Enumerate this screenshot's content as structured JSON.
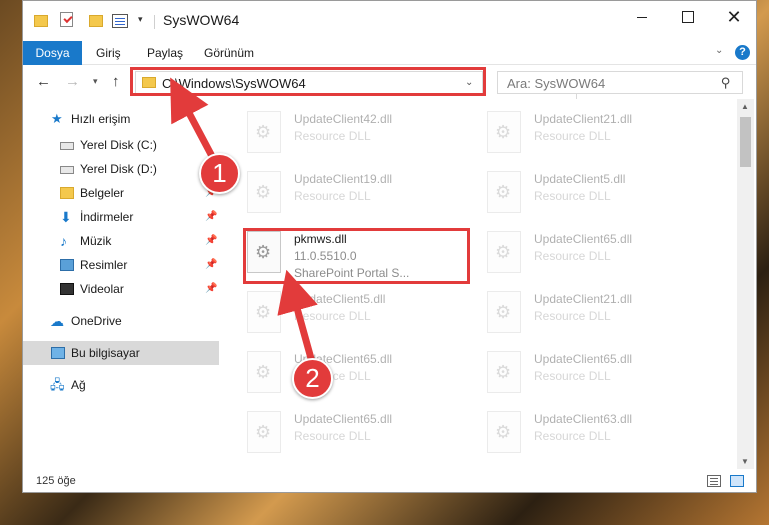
{
  "window": {
    "title": "SysWOW64"
  },
  "ribbon": {
    "tabs": [
      "Dosya",
      "Giriş",
      "Paylaş",
      "Görünüm"
    ]
  },
  "address": {
    "path": "C:\\Windows\\SysWOW64"
  },
  "search": {
    "placeholder": "Ara: SysWOW64"
  },
  "nav": {
    "items": [
      {
        "label": "Hızlı erişim",
        "icon": "star-icon",
        "pinned": false
      },
      {
        "label": "Yerel Disk (C:)",
        "icon": "drive-icon",
        "pinned": false
      },
      {
        "label": "Yerel Disk (D:)",
        "icon": "drive-icon",
        "pinned": false
      },
      {
        "label": "Belgeler",
        "icon": "documents-icon",
        "pinned": true
      },
      {
        "label": "İndirmeler",
        "icon": "downloads-icon",
        "pinned": true
      },
      {
        "label": "Müzik",
        "icon": "music-icon",
        "pinned": true
      },
      {
        "label": "Resimler",
        "icon": "pictures-icon",
        "pinned": true
      },
      {
        "label": "Videolar",
        "icon": "videos-icon",
        "pinned": true
      },
      {
        "label": "OneDrive",
        "icon": "cloud-icon",
        "pinned": false
      },
      {
        "label": "Bu bilgisayar",
        "icon": "computer-icon",
        "pinned": false
      },
      {
        "label": "Ağ",
        "icon": "network-icon",
        "pinned": false
      }
    ]
  },
  "files": {
    "left": [
      {
        "name": "UpdateClient42.dll",
        "desc": "Resource DLL"
      },
      {
        "name": "UpdateClient19.dll",
        "desc": "Resource DLL"
      },
      {
        "name": "pkmws.dll",
        "desc": "11.0.5510.0",
        "desc2": "SharePoint Portal S..."
      },
      {
        "name": "UpdateClient5.dll",
        "desc": "Resource DLL"
      },
      {
        "name": "UpdateClient65.dll",
        "desc": "Resource DLL"
      },
      {
        "name": "UpdateClient65.dll",
        "desc": "Resource DLL"
      }
    ],
    "right": [
      {
        "name": "UpdateClient21.dll",
        "desc": "Resource DLL"
      },
      {
        "name": "UpdateClient5.dll",
        "desc": "Resource DLL"
      },
      {
        "name": "UpdateClient65.dll",
        "desc": "Resource DLL"
      },
      {
        "name": "UpdateClient21.dll",
        "desc": "Resource DLL"
      },
      {
        "name": "UpdateClient65.dll",
        "desc": "Resource DLL"
      },
      {
        "name": "UpdateClient63.dll",
        "desc": "Resource DLL"
      }
    ]
  },
  "status": {
    "count": "125 öğe"
  },
  "annotations": {
    "step1": "1",
    "step2": "2"
  },
  "colors": {
    "accent": "#1979ca",
    "highlight": "#e23b3b"
  }
}
